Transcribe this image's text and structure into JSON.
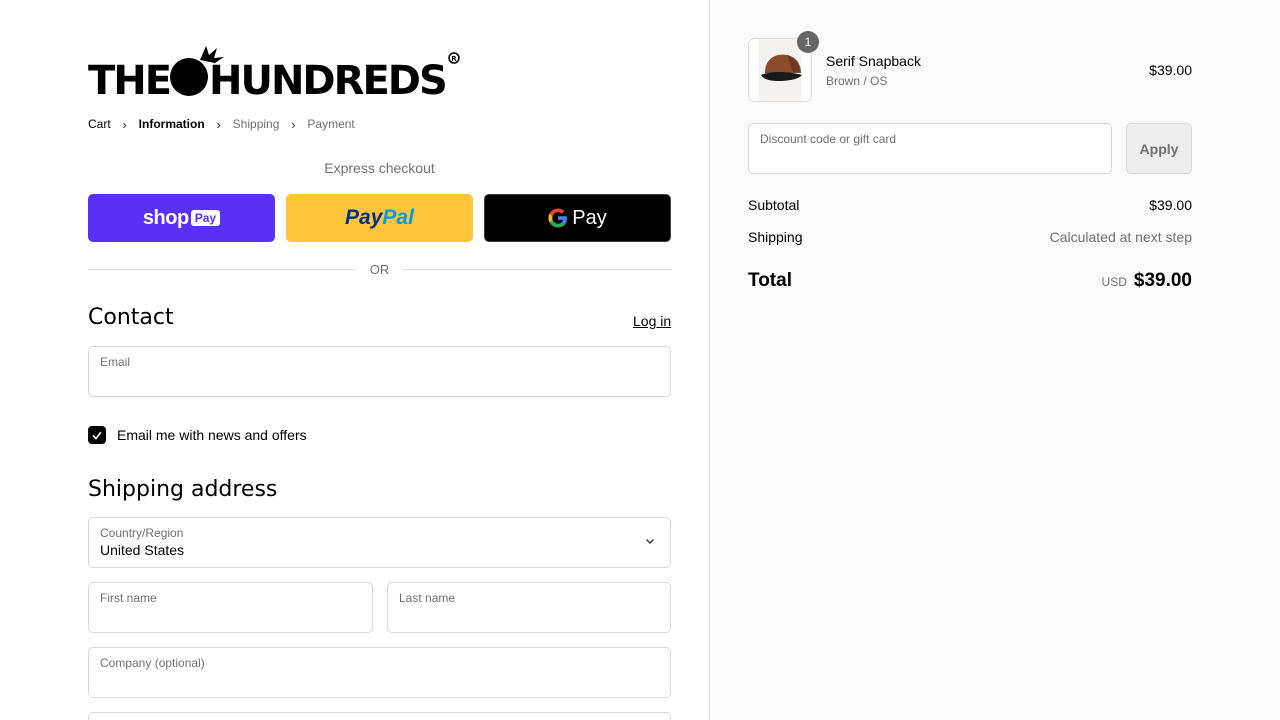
{
  "brand": {
    "logo_text": "THE HUNDREDS",
    "logo_mark": "R"
  },
  "breadcrumb": {
    "items": [
      {
        "label": "Cart"
      },
      {
        "label": "Information"
      },
      {
        "label": "Shipping"
      },
      {
        "label": "Payment"
      }
    ]
  },
  "express": {
    "label": "Express checkout",
    "shop_pay": {
      "label": "shop",
      "badge": "Pay"
    },
    "paypal": {
      "part1": "Pay",
      "part2": "Pal"
    },
    "gpay": {
      "g": "G",
      "label": "Pay"
    },
    "or_label": "OR"
  },
  "contact": {
    "heading": "Contact",
    "login_link": "Log in",
    "email_label": "Email",
    "email_value": "",
    "newsletter_label": "Email me with news and offers",
    "newsletter_checked": true
  },
  "shipping": {
    "heading": "Shipping address",
    "country_label": "Country/Region",
    "country_value": "United States",
    "first_name_label": "First name",
    "last_name_label": "Last name",
    "company_label": "Company (optional)"
  },
  "order": {
    "item": {
      "quantity": "1",
      "name": "Serif Snapback",
      "variant": "Brown / OS",
      "price": "$39.00"
    },
    "discount_placeholder": "Discount code or gift card",
    "apply_label": "Apply",
    "subtotal_label": "Subtotal",
    "subtotal_value": "$39.00",
    "shipping_label": "Shipping",
    "shipping_value": "Calculated at next step",
    "total_label": "Total",
    "total_currency": "USD",
    "total_value": "$39.00"
  },
  "colors": {
    "shop_pay": "#5a31f4",
    "paypal": "#ffc439",
    "gpay": "#000000",
    "accent": "#000000"
  }
}
